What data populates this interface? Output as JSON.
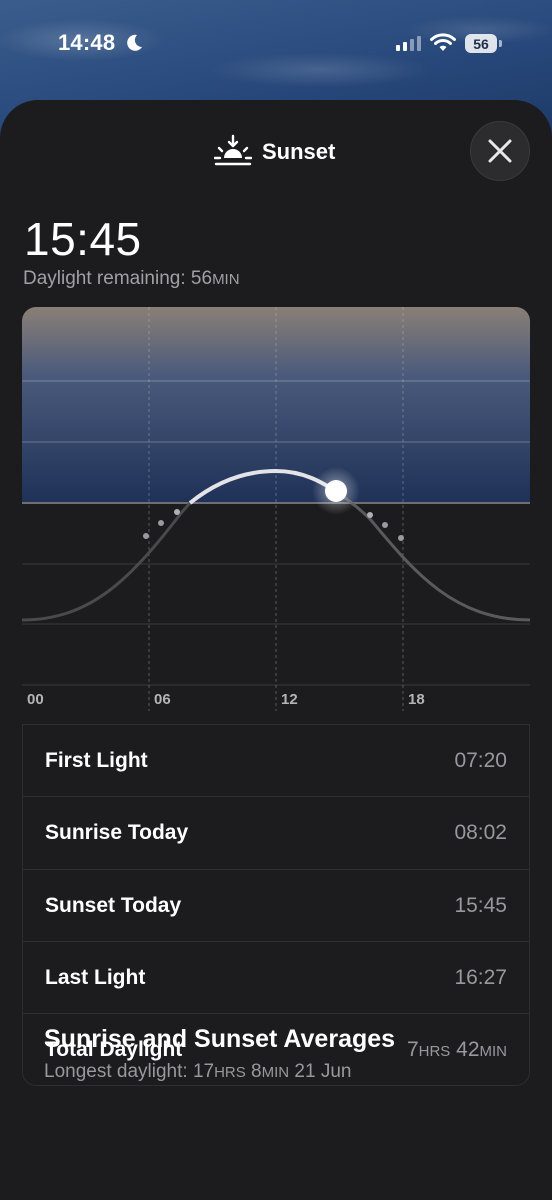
{
  "status_bar": {
    "time": "14:48",
    "battery": "56",
    "focus_icon": "moon-icon"
  },
  "sheet": {
    "title": "Sunset",
    "title_icon": "sunset-icon",
    "close_icon": "close-icon"
  },
  "summary": {
    "time": "15:45",
    "remaining_label": "Daylight remaining: ",
    "remaining_value": "56",
    "remaining_unit": "MIN"
  },
  "chart_data": {
    "type": "line",
    "x_ticks": [
      "00",
      "06",
      "12",
      "18"
    ],
    "current_time": "15:45",
    "colors": {
      "day_sky_top": "#8a7f76",
      "day_sky_bottom": "#1f3157",
      "night": "#1c1c1e",
      "curve": "#d9d9de"
    }
  },
  "rows": [
    {
      "label": "First Light",
      "value": "07:20"
    },
    {
      "label": "Sunrise Today",
      "value": "08:02"
    },
    {
      "label": "Sunset Today",
      "value": "15:45"
    },
    {
      "label": "Last Light",
      "value": "16:27"
    },
    {
      "label": "Total Daylight",
      "value_hrs": "7",
      "hrs_unit": "HRS",
      "value_min": "42",
      "min_unit": "MIN"
    }
  ],
  "averages": {
    "title": "Sunrise and Sunset Averages",
    "sub_label": "Longest daylight: ",
    "sub_hrs": "17",
    "hrs_unit": "HRS",
    "sub_min": "8",
    "min_unit": "MIN",
    "sub_date": " 21 Jun"
  }
}
